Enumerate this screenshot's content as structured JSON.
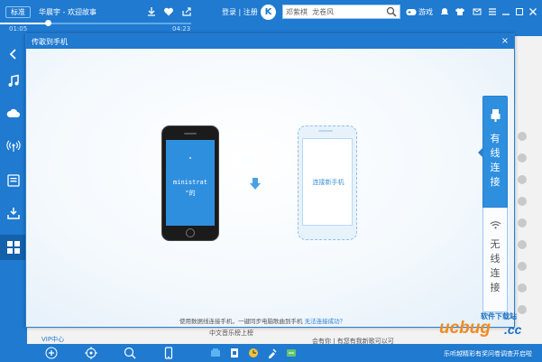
{
  "player": {
    "quality_label": "标准",
    "song_title": "华晨宇 - 欢迎故事",
    "time_elapsed": "01:05",
    "time_total": "04:23",
    "progress": 0.25
  },
  "header": {
    "login_text": "登录 | 注册",
    "logo_text": "K",
    "search_value": "邓紫棋  龙卷风",
    "game_label": "游戏"
  },
  "dialog": {
    "title": "传歌到手机",
    "close_symbol": "×",
    "phone_screen_lines": [
      "\"",
      "ministrat",
      "\"的"
    ],
    "new_phone_label": "连接新手机",
    "hint_text": "使用数据线连接手机，一键同步电脑歌曲到手机",
    "hint_link": "无法连接成功？",
    "wired_chars": [
      "有",
      "线",
      "连",
      "接"
    ],
    "wireless_chars": [
      "无",
      "线",
      "连",
      "接"
    ]
  },
  "background": {
    "vip_label": "VIP中心",
    "list_item_1": "中文音乐榜上榜",
    "list_item_2": "会有你 | 有您有我新歌可以可"
  },
  "footer": {
    "note": "乐听越精彩有奖问卷调查开启啦"
  },
  "watermark": {
    "main": "ucbug",
    "suffix": ".cc",
    "sub": "软件下载站"
  },
  "colors": {
    "primary": "#1f7ad0",
    "accent": "#2f8fdf",
    "watermark_orange": "#f28b1e",
    "watermark_blue": "#1a6fc4"
  }
}
